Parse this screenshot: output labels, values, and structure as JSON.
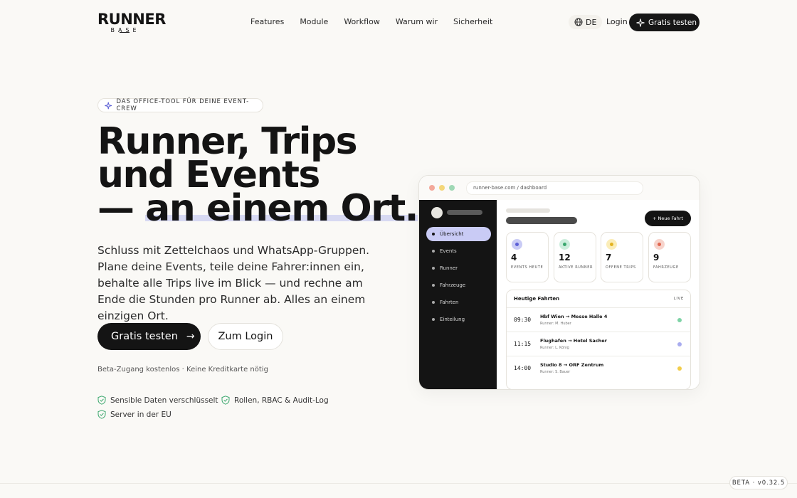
{
  "nav": {
    "logo_main": "RUNNER",
    "logo_sub": "BASE",
    "links": [
      "Features",
      "Module",
      "Workflow",
      "Warum wir",
      "Sicherheit"
    ],
    "lang": "DE",
    "login": "Login",
    "cta": "Gratis testen"
  },
  "hero": {
    "badge": "DAS OFFICE-TOOL FÜR DEINE EVENT-CREW",
    "headline_1": "Runner, Trips",
    "headline_2": "und Events",
    "headline_3_prefix": "— ",
    "headline_3_accent": "an einem Ort.",
    "lead": "Schluss mit Zettelchaos und WhatsApp-Gruppen. Plane deine Events, teile deine Fahrer:innen ein, behalte alle Trips live im Blick — und rechne am Ende die Stunden pro Runner ab. Alles an einem einzigen Ort.",
    "primary_cta": "Gratis testen",
    "secondary_cta": "Zum Login",
    "note": "Beta-Zugang kostenlos · Keine Kreditkarte nötig",
    "features": [
      "Sensible Daten verschlüsselt",
      "Rollen, RBAC & Audit-Log",
      "Server in der EU"
    ]
  },
  "mockup": {
    "url": "runner-base.com / dashboard",
    "sidebar": [
      "Übersicht",
      "Events",
      "Runner",
      "Fahrzeuge",
      "Fahrten",
      "Einteilung"
    ],
    "new_button": "+ Neue Fahrt",
    "kpis": [
      {
        "value": "4",
        "label": "EVENTS HEUTE",
        "color": "#c9cbf5",
        "dot": "#5b5fd6"
      },
      {
        "value": "12",
        "label": "AKTIVE RUNNER",
        "color": "#cdeedd",
        "dot": "#3aa76d"
      },
      {
        "value": "7",
        "label": "OFFENE TRIPS",
        "color": "#fbedb8",
        "dot": "#e3b321"
      },
      {
        "value": "9",
        "label": "FAHRZEUGE",
        "color": "#f7d3cb",
        "dot": "#e0664f"
      }
    ],
    "trips_title": "Heutige Fahrten",
    "trips_live": "LIVE",
    "trips": [
      {
        "time": "09:30",
        "route": "Hbf Wien → Messe Halle 4",
        "runner": "Runner: M. Huber",
        "status": "#7ed3a6"
      },
      {
        "time": "11:15",
        "route": "Flughafen → Hotel Sacher",
        "runner": "Runner: L. König",
        "status": "#a9acef"
      },
      {
        "time": "14:00",
        "route": "Studio 8 → ORF Zentrum",
        "runner": "Runner: S. Bauer",
        "status": "#f2cd4a"
      }
    ]
  },
  "footer": {
    "version": "BETA · v0.32.5"
  }
}
